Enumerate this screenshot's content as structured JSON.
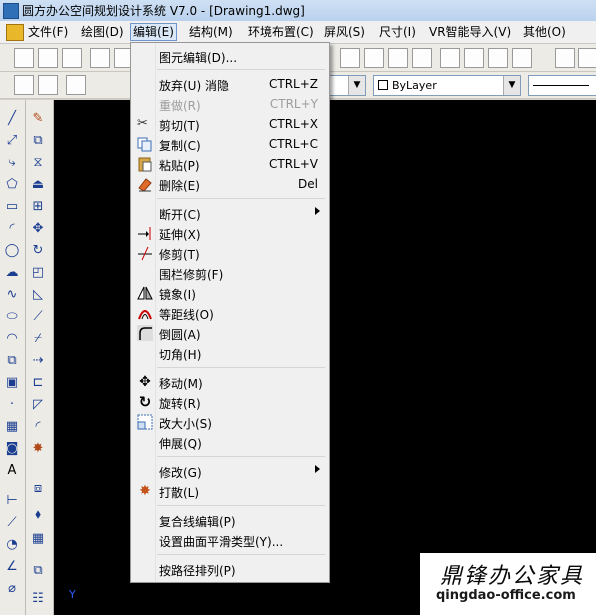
{
  "window": {
    "title": "圆方办公空间规划设计系统 V7.0 - [Drawing1.dwg]"
  },
  "menubar": [
    {
      "label": "文件(F)"
    },
    {
      "label": "绘图(D)"
    },
    {
      "label": "编辑(E)",
      "active": true
    },
    {
      "label": "结构(M)"
    },
    {
      "label": "环境布置(C)"
    },
    {
      "label": "屏风(S)"
    },
    {
      "label": "尺寸(I)"
    },
    {
      "label": "VR智能导入(V)"
    },
    {
      "label": "其他(O)"
    }
  ],
  "toolbar": {
    "linetype_combo": "ByLayer"
  },
  "dropdown": {
    "items": [
      {
        "label": "图元编辑(D)...",
        "icon": ""
      },
      {
        "label": "放弃(U) 消隐",
        "shortcut": "CTRL+Z",
        "icon": ""
      },
      {
        "label": "重做(R)",
        "shortcut": "CTRL+Y",
        "disabled": true,
        "icon": ""
      },
      {
        "label": "剪切(T)",
        "shortcut": "CTRL+X",
        "icon": "scissors-icon"
      },
      {
        "label": "复制(C)",
        "shortcut": "CTRL+C",
        "icon": "copy-icon"
      },
      {
        "label": "粘贴(P)",
        "shortcut": "CTRL+V",
        "icon": "paste-icon"
      },
      {
        "label": "删除(E)",
        "shortcut": "Del",
        "icon": "erase-icon"
      },
      {
        "label": "断开(C)",
        "submenu": true,
        "icon": ""
      },
      {
        "label": "延伸(X)",
        "icon": "extend-icon"
      },
      {
        "label": "修剪(T)",
        "icon": "trim-icon"
      },
      {
        "label": "围栏修剪(F)",
        "icon": ""
      },
      {
        "label": "镜象(I)",
        "icon": "mirror-icon"
      },
      {
        "label": "等距线(O)",
        "icon": "offset-icon"
      },
      {
        "label": "倒圆(A)",
        "icon": "fillet-icon"
      },
      {
        "label": "切角(H)",
        "icon": ""
      },
      {
        "label": "移动(M)",
        "icon": "move-icon"
      },
      {
        "label": "旋转(R)",
        "icon": "rotate-icon"
      },
      {
        "label": "改大小(S)",
        "icon": "scale-icon"
      },
      {
        "label": "伸展(Q)",
        "icon": ""
      },
      {
        "label": "修改(G)",
        "submenu": true,
        "icon": ""
      },
      {
        "label": "打散(L)",
        "icon": "explode-icon"
      },
      {
        "label": "复合线编辑(P)",
        "icon": ""
      },
      {
        "label": "设置曲面平滑类型(Y)...",
        "icon": ""
      },
      {
        "label": "按路径排列(P)",
        "icon": ""
      }
    ]
  },
  "canvas": {
    "ucs_label": "Y",
    "watermark_cn": "鼎锋办公家具",
    "watermark_url": "qingdao-office.com"
  }
}
